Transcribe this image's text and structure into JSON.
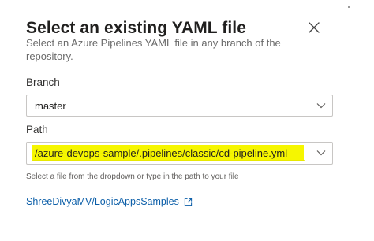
{
  "dialog": {
    "title": "Select an existing YAML file",
    "subtitle": "Select an Azure Pipelines YAML file in any branch of the repository."
  },
  "branch": {
    "label": "Branch",
    "value": "master"
  },
  "path": {
    "label": "Path",
    "value": "/azure-devops-sample/.pipelines/classic/cd-pipeline.yml",
    "highlight_color": "#f6f600"
  },
  "helper_text": "Select a file from the dropdown or type in the path to your file",
  "repo_link": {
    "text": "ShreeDivyaMV/LogicAppsSamples"
  },
  "icons": {
    "close": "close-icon",
    "dropdown": "chevron-down-icon",
    "external": "external-link-icon"
  }
}
